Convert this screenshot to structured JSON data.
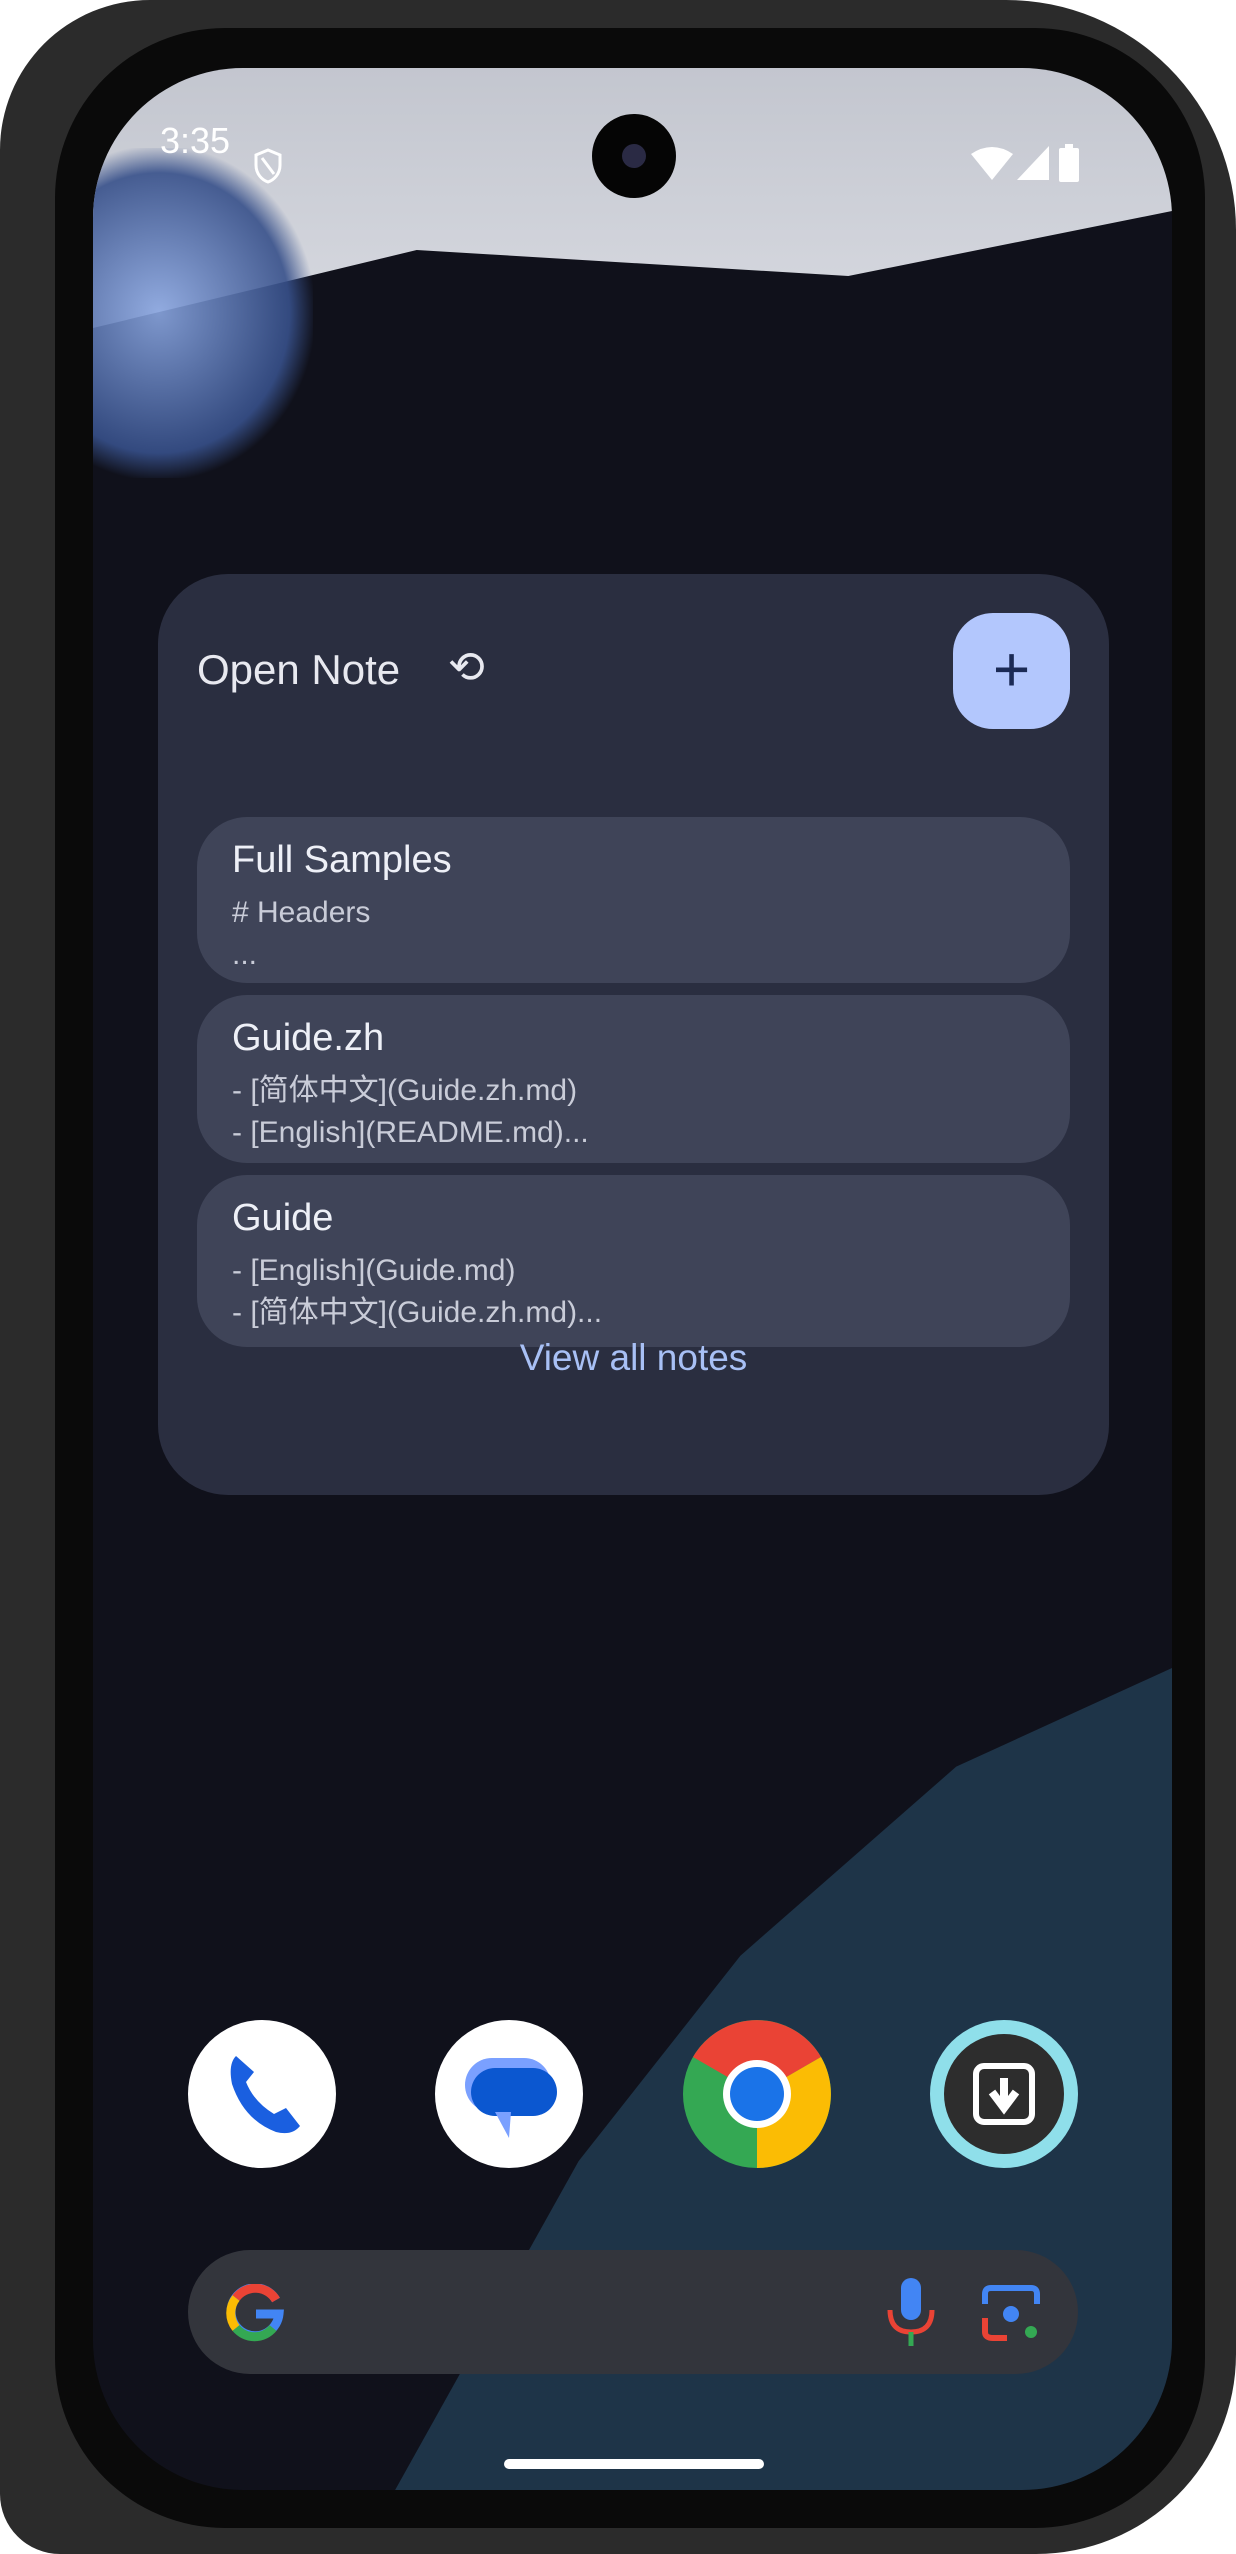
{
  "status_bar": {
    "time": "3:35",
    "icons": [
      "shield-icon",
      "wifi-icon",
      "signal-icon",
      "battery-icon"
    ]
  },
  "widget": {
    "title": "Open Note",
    "refresh_icon": "refresh-icon",
    "add_icon": "plus-icon",
    "accent": "#b3c7fd",
    "notes": [
      {
        "title": "Full Samples",
        "lines": [
          "# Headers",
          "..."
        ]
      },
      {
        "title": "Guide.zh",
        "lines": [
          "- [简体中文](Guide.zh.md)",
          "- [English](README.md)..."
        ]
      },
      {
        "title": "Guide",
        "lines": [
          "- [English](Guide.md)",
          "- [简体中文](Guide.zh.md)..."
        ]
      }
    ],
    "view_all": "View all notes"
  },
  "dock": [
    "phone-icon",
    "messages-icon",
    "chrome-icon",
    "open-note-app-icon"
  ],
  "search_bar": {
    "icons": [
      "google-icon",
      "mic-icon",
      "lens-icon"
    ]
  }
}
